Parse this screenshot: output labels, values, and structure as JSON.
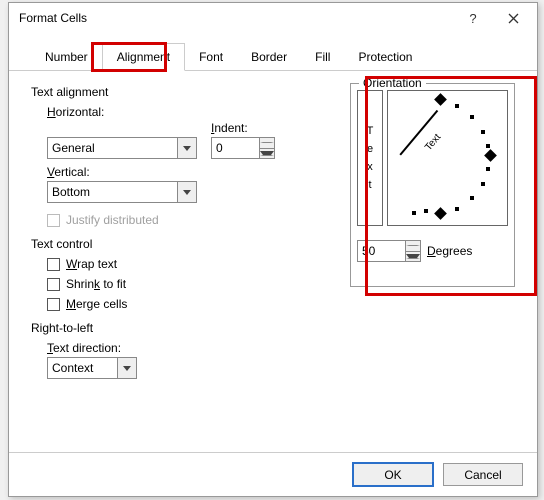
{
  "title": "Format Cells",
  "tabs": [
    "Number",
    "Alignment",
    "Font",
    "Border",
    "Fill",
    "Protection"
  ],
  "textAlignment": {
    "section": "Text alignment",
    "horizontalLabel": "Horizontal:",
    "horizontalValue": "General",
    "indentLabel": "Indent:",
    "indentValue": "0",
    "verticalLabel": "Vertical:",
    "verticalValue": "Bottom",
    "justify": "Justify distributed"
  },
  "textControl": {
    "section": "Text control",
    "wrap": "Wrap text",
    "shrink": "Shrink to fit",
    "merge": "Merge cells"
  },
  "rtl": {
    "section": "Right-to-left",
    "dirLabel": "Text direction:",
    "dirValue": "Context"
  },
  "orientation": {
    "section": "Orientation",
    "vertical": "Text",
    "needle": "Text",
    "degreesLabel": "Degrees",
    "degreesValue": "50"
  },
  "buttons": {
    "ok": "OK",
    "cancel": "Cancel"
  }
}
